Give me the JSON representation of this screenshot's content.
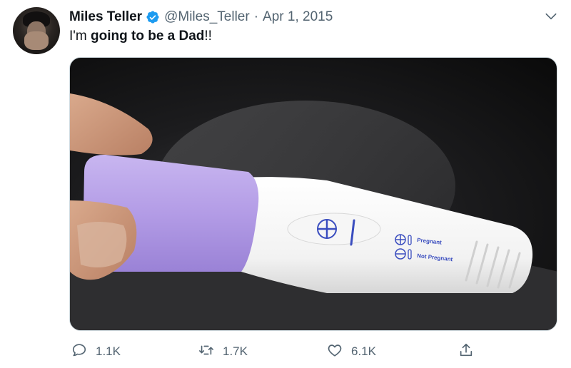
{
  "tweet": {
    "author_name": "Miles Teller",
    "handle": "@Miles_Teller",
    "separator": "·",
    "date": "Apr 1, 2015",
    "text_prefix": "I'm ",
    "text_bold": "going to be a Dad",
    "text_suffix": "!!"
  },
  "media": {
    "labels": {
      "pregnant": "Pregnant",
      "not_pregnant": "Not Pregnant"
    }
  },
  "actions": {
    "reply_count": "1.1K",
    "retweet_count": "1.7K",
    "like_count": "6.1K"
  },
  "colors": {
    "verified_badge": "#1d9bf0",
    "secondary_text": "#536471",
    "test_cap": "#b9a6e8"
  },
  "icons": [
    "verified-icon",
    "chevron-down-icon",
    "reply-icon",
    "retweet-icon",
    "like-icon",
    "share-icon"
  ]
}
